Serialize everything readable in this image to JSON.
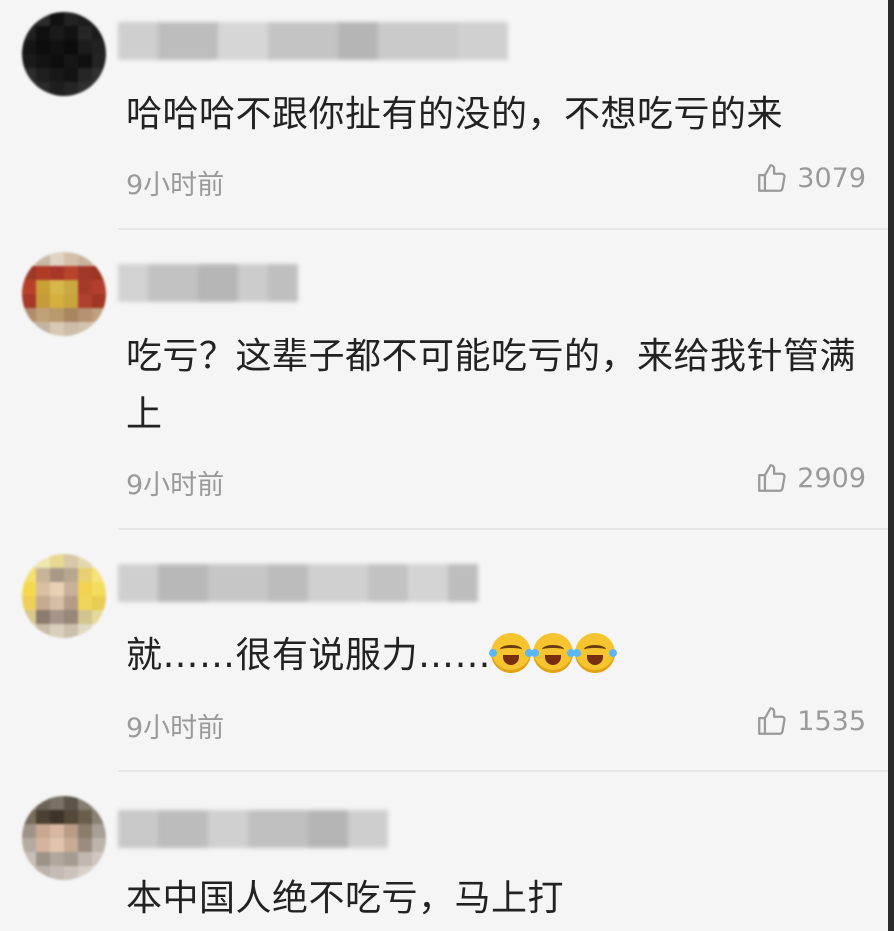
{
  "comments": [
    {
      "text": "哈哈哈不跟你扯有的没的，不想吃亏的来",
      "time": "9小时前",
      "likes": "3079",
      "emoji_count": 0
    },
    {
      "text": "吃亏？这辈子都不可能吃亏的，来给我针管满上",
      "time": "9小时前",
      "likes": "2909",
      "emoji_count": 0
    },
    {
      "text": "就……很有说服力……",
      "time": "9小时前",
      "likes": "1535",
      "emoji_count": 3,
      "emoji_name": "laugh-cry-emoji"
    },
    {
      "text": "本中国人绝不吃亏，马上打",
      "time": "",
      "likes": "",
      "emoji_count": 0
    }
  ],
  "icons": {
    "like": "thumbs-up-icon"
  },
  "colors": {
    "background": "#f5f5f5",
    "text": "#222222",
    "meta": "#9a9a9a"
  }
}
